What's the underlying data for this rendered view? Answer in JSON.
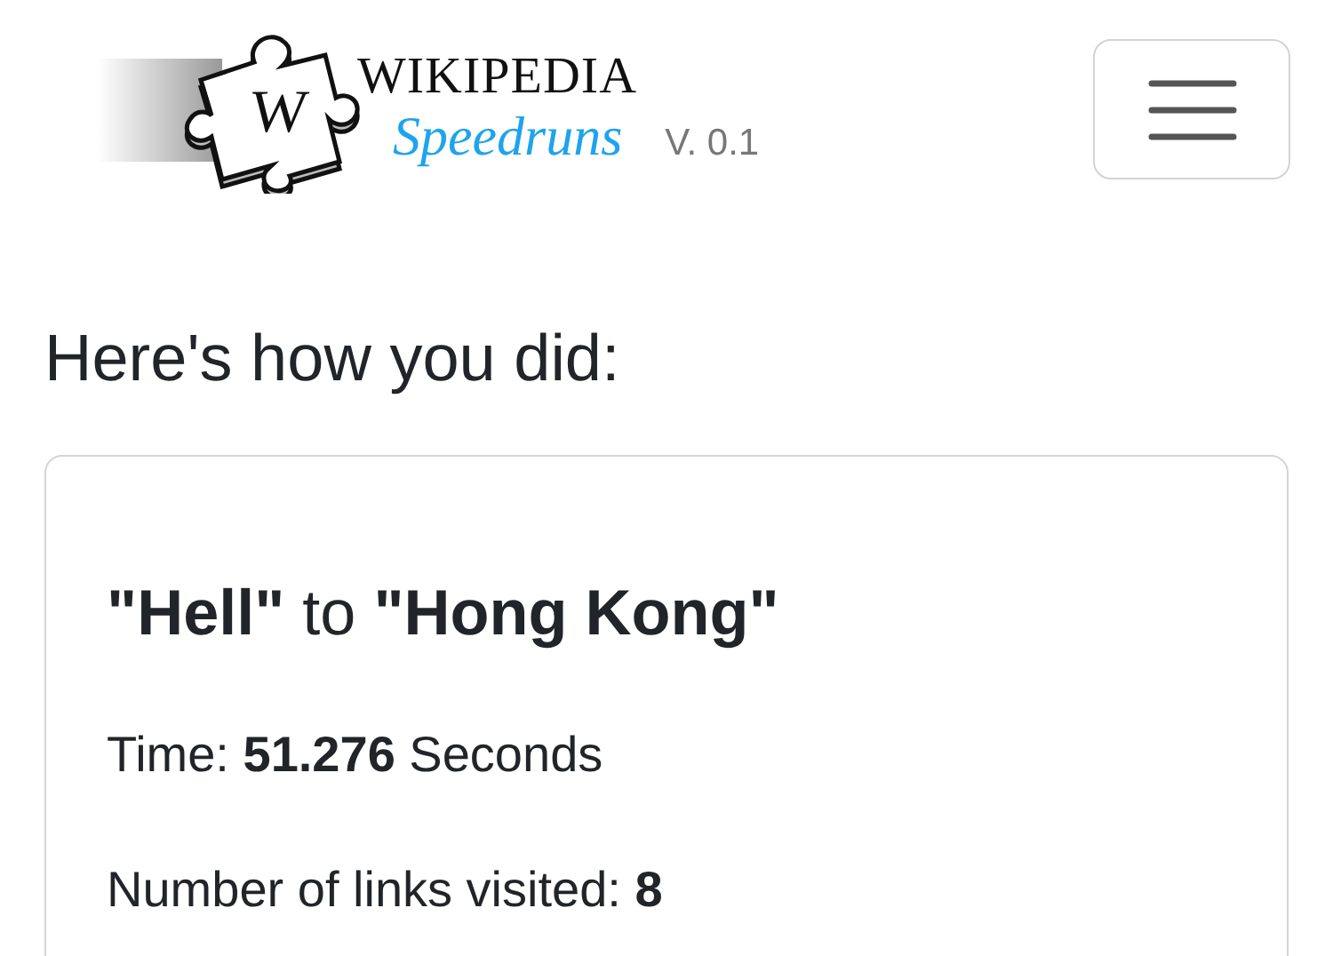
{
  "header": {
    "logo": {
      "mark": "W",
      "name": "WIKIPEDIA",
      "subtitle": "Speedruns",
      "version": "V. 0.1"
    },
    "menu_button": {
      "expanded": false
    }
  },
  "heading": "Here's how you did:",
  "result": {
    "title": "**\"Hell\"** to **\"Hong Kong\"**",
    "lines": [
      "Time: **51.276** Seconds",
      "Number of links visited: **8**"
    ]
  }
}
